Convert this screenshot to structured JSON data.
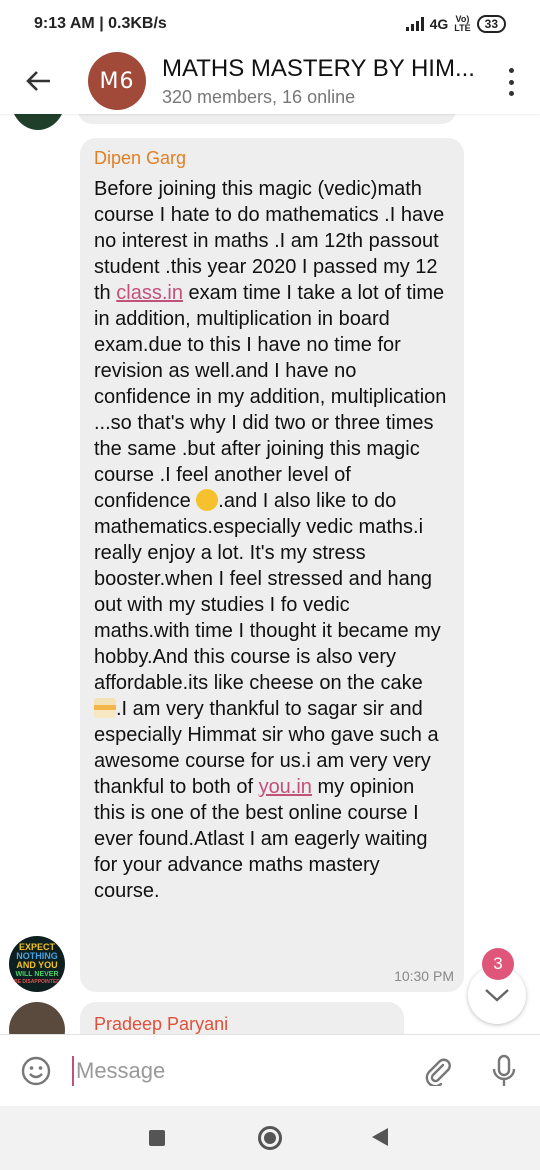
{
  "status_bar": {
    "time_speed": "9:13 AM | 0.3KB/s",
    "network": "4G",
    "volte_top": "Vo)",
    "volte_bottom": "LTE",
    "battery": "33"
  },
  "header": {
    "avatar_text": "M6",
    "title": "MATHS MASTERY BY HIM...",
    "subtitle": "320 members, 16 online"
  },
  "messages": [
    {
      "sender": "Dipen Garg",
      "text_1": "Before joining this magic (vedic)math course I hate to do mathematics .I have no interest in maths .I am 12th passout student .this year 2020 I passed my 12 th ",
      "link_1": "class.in",
      "text_2": " exam time I take a lot of time in addition, multiplication in board exam.due to this I have no time for revision as well.and I have no confidence in my addition, multiplication ...so that's why I did two or three times the same .but after joining this magic course .I feel another level of confidence ",
      "text_3": ".and I also like to do mathematics.especially vedic maths.i really enjoy a lot. It's my stress booster.when I feel stressed and hang out with my studies I fo vedic maths.with time I thought it became my hobby.And this course is also very affordable.its like cheese on the cake ",
      "text_4": ".I am very thankful to sagar sir and especially Himmat sir who gave such a awesome course for us.i am very very thankful to both of ",
      "link_2": "you.in",
      "text_5": " my opinion this is one of the best online course I ever found.Atlast I am eagerly waiting for your advance maths mastery course.",
      "time": "10:30 PM",
      "avatar_lines": [
        "EXPECT",
        "NOTHING",
        "AND YOU",
        "WILL NEVER",
        "BE DISAPPOINTED"
      ]
    },
    {
      "sender": "Pradeep Paryani"
    }
  ],
  "unread_badge": "3",
  "input": {
    "placeholder": "Message"
  },
  "icons": {
    "back": "arrow-left-icon",
    "menu": "more-vert-icon",
    "emoji": "smiley-icon",
    "attach": "paperclip-icon",
    "mic": "microphone-icon",
    "scroll": "chevron-down-icon"
  },
  "colors": {
    "avatar_bg": "#a14a39",
    "sender_orange": "#e08024",
    "sender_red": "#e0503a",
    "link": "#c2517a",
    "badge": "#e0567a",
    "bubble": "#eeeeee"
  }
}
